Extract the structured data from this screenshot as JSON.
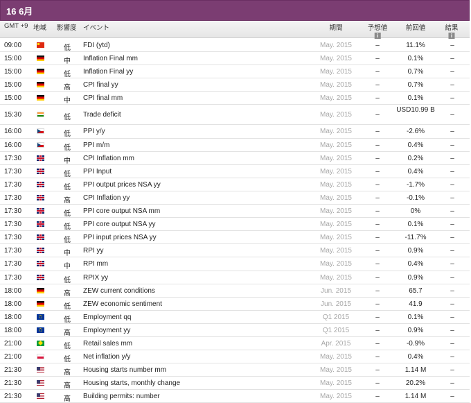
{
  "header": {
    "date_title": "16 6月"
  },
  "columns": {
    "time": "GMT +9",
    "region": "地域",
    "impact": "影響度",
    "event": "イベント",
    "period": "期間",
    "forecast": "予想値",
    "previous": "前回値",
    "result": "結果",
    "info_icon": "info-icon"
  },
  "rows": [
    {
      "time": "09:00",
      "flag": "cn",
      "impact": "低",
      "event": "FDI (ytd)",
      "period": "May. 2015",
      "forecast": "–",
      "previous": "11.1%",
      "result": "–"
    },
    {
      "time": "15:00",
      "flag": "de",
      "impact": "中",
      "event": "Inflation Final mm",
      "period": "May. 2015",
      "forecast": "–",
      "previous": "0.1%",
      "result": "–"
    },
    {
      "time": "15:00",
      "flag": "de",
      "impact": "低",
      "event": "Inflation Final yy",
      "period": "May. 2015",
      "forecast": "–",
      "previous": "0.7%",
      "result": "–"
    },
    {
      "time": "15:00",
      "flag": "de",
      "impact": "高",
      "event": "CPI final yy",
      "period": "May. 2015",
      "forecast": "–",
      "previous": "0.7%",
      "result": "–"
    },
    {
      "time": "15:00",
      "flag": "de",
      "impact": "中",
      "event": "CPI final mm",
      "period": "May. 2015",
      "forecast": "–",
      "previous": "0.1%",
      "result": "–"
    },
    {
      "time": "15:30",
      "flag": "in",
      "impact": "低",
      "event": "Trade deficit",
      "period": "May. 2015",
      "forecast": "–",
      "previous": "USD10.99 B",
      "result": "–"
    },
    {
      "time": "16:00",
      "flag": "cz",
      "impact": "低",
      "event": "PPI y/y",
      "period": "May. 2015",
      "forecast": "–",
      "previous": "-2.6%",
      "result": "–"
    },
    {
      "time": "16:00",
      "flag": "cz",
      "impact": "低",
      "event": "PPI m/m",
      "period": "May. 2015",
      "forecast": "–",
      "previous": "0.4%",
      "result": "–"
    },
    {
      "time": "17:30",
      "flag": "gb",
      "impact": "中",
      "event": "CPI Inflation mm",
      "period": "May. 2015",
      "forecast": "–",
      "previous": "0.2%",
      "result": "–"
    },
    {
      "time": "17:30",
      "flag": "gb",
      "impact": "低",
      "event": "PPI Input",
      "period": "May. 2015",
      "forecast": "–",
      "previous": "0.4%",
      "result": "–"
    },
    {
      "time": "17:30",
      "flag": "gb",
      "impact": "低",
      "event": "PPI output prices NSA yy",
      "period": "May. 2015",
      "forecast": "–",
      "previous": "-1.7%",
      "result": "–"
    },
    {
      "time": "17:30",
      "flag": "gb",
      "impact": "高",
      "event": "CPI Inflation yy",
      "period": "May. 2015",
      "forecast": "–",
      "previous": "-0.1%",
      "result": "–"
    },
    {
      "time": "17:30",
      "flag": "gb",
      "impact": "低",
      "event": "PPI core output NSA mm",
      "period": "May. 2015",
      "forecast": "–",
      "previous": "0%",
      "result": "–"
    },
    {
      "time": "17:30",
      "flag": "gb",
      "impact": "低",
      "event": "PPI core output NSA yy",
      "period": "May. 2015",
      "forecast": "–",
      "previous": "0.1%",
      "result": "–"
    },
    {
      "time": "17:30",
      "flag": "gb",
      "impact": "低",
      "event": "PPI input prices NSA yy",
      "period": "May. 2015",
      "forecast": "–",
      "previous": "-11.7%",
      "result": "–"
    },
    {
      "time": "17:30",
      "flag": "gb",
      "impact": "中",
      "event": "RPI yy",
      "period": "May. 2015",
      "forecast": "–",
      "previous": "0.9%",
      "result": "–"
    },
    {
      "time": "17:30",
      "flag": "gb",
      "impact": "中",
      "event": "RPI mm",
      "period": "May. 2015",
      "forecast": "–",
      "previous": "0.4%",
      "result": "–"
    },
    {
      "time": "17:30",
      "flag": "gb",
      "impact": "低",
      "event": "RPIX yy",
      "period": "May. 2015",
      "forecast": "–",
      "previous": "0.9%",
      "result": "–"
    },
    {
      "time": "18:00",
      "flag": "de",
      "impact": "高",
      "event": "ZEW current conditions",
      "period": "Jun. 2015",
      "forecast": "–",
      "previous": "65.7",
      "result": "–"
    },
    {
      "time": "18:00",
      "flag": "de",
      "impact": "低",
      "event": "ZEW economic sentiment",
      "period": "Jun. 2015",
      "forecast": "–",
      "previous": "41.9",
      "result": "–"
    },
    {
      "time": "18:00",
      "flag": "eu",
      "impact": "低",
      "event": "Employment qq",
      "period": "Q1 2015",
      "forecast": "–",
      "previous": "0.1%",
      "result": "–"
    },
    {
      "time": "18:00",
      "flag": "eu",
      "impact": "高",
      "event": "Employment yy",
      "period": "Q1 2015",
      "forecast": "–",
      "previous": "0.9%",
      "result": "–"
    },
    {
      "time": "21:00",
      "flag": "br",
      "impact": "低",
      "event": "Retail sales mm",
      "period": "Apr. 2015",
      "forecast": "–",
      "previous": "-0.9%",
      "result": "–"
    },
    {
      "time": "21:00",
      "flag": "pl",
      "impact": "低",
      "event": "Net inflation y/y",
      "period": "May. 2015",
      "forecast": "–",
      "previous": "0.4%",
      "result": "–"
    },
    {
      "time": "21:30",
      "flag": "us",
      "impact": "高",
      "event": "Housing starts number mm",
      "period": "May. 2015",
      "forecast": "–",
      "previous": "1.14 M",
      "result": "–"
    },
    {
      "time": "21:30",
      "flag": "us",
      "impact": "高",
      "event": "Housing starts, monthly change",
      "period": "May. 2015",
      "forecast": "–",
      "previous": "20.2%",
      "result": "–"
    },
    {
      "time": "21:30",
      "flag": "us",
      "impact": "高",
      "event": "Building permits: number",
      "period": "May. 2015",
      "forecast": "–",
      "previous": "1.14 M",
      "result": "–"
    }
  ],
  "colors": {
    "title_bar": "#7b3d72",
    "period_text": "#a8a8a8"
  }
}
